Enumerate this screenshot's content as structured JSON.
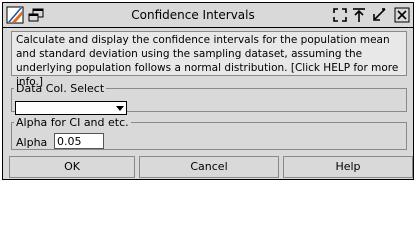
{
  "window": {
    "title": "Confidence Intervals"
  },
  "titlebar_icons": {
    "left": [
      "java-icon",
      "restore-window-icon"
    ],
    "right": [
      "maximize-icon",
      "pin-top-icon",
      "minimize-icon",
      "close-icon"
    ]
  },
  "description": "Calculate and display the confidence intervals for the population mean and standard deviation using the sampling dataset, assuming the underlying population follows a normal distribution. [Click HELP for more info.]",
  "data_col": {
    "legend": "Data Col. Select",
    "selected": ""
  },
  "alpha": {
    "legend": "Alpha for CI and etc.",
    "label": "Alpha",
    "value": "0.05"
  },
  "buttons": {
    "ok": "OK",
    "cancel": "Cancel",
    "help": "Help"
  }
}
